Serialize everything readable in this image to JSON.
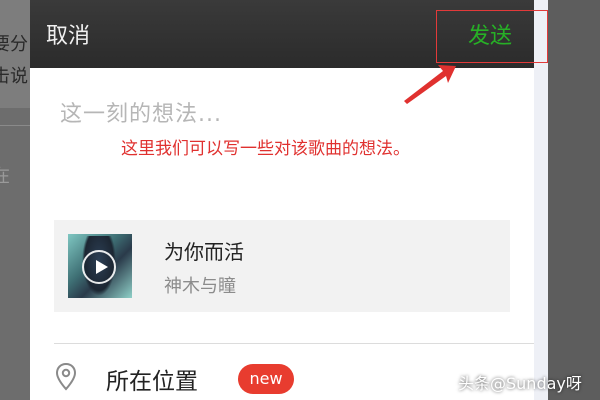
{
  "background": {
    "snippet_1": "要分",
    "snippet_2": "击说",
    "snippet_3": "在"
  },
  "header": {
    "cancel_label": "取消",
    "send_label": "发送"
  },
  "composer": {
    "placeholder": "这一刻的想法...",
    "annotation": "这里我们可以写一些对该歌曲的想法。"
  },
  "song": {
    "title": "为你而活",
    "artist": "神木与瞳"
  },
  "location": {
    "label": "所在位置",
    "badge": "new",
    "icon": "location-pin-icon"
  },
  "watermark": "头条@Sunday呀",
  "colors": {
    "send_green": "#27b026",
    "annotation_red": "#e0312f",
    "badge_red": "#e83c2f",
    "topbar": "#2b2b2b"
  }
}
